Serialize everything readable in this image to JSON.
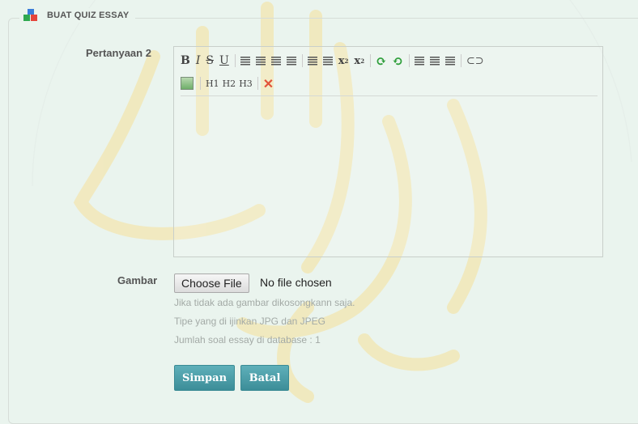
{
  "section": {
    "title": "BUAT QUIZ ESSAY",
    "icon": "blocks-icon"
  },
  "question": {
    "label": "Pertanyaan 2"
  },
  "toolbar": {
    "bold": "B",
    "italic": "I",
    "strike": "S",
    "underline": "U",
    "subscript": "x",
    "superscript": "x",
    "h1": "H1",
    "h2": "H2",
    "h3": "H3"
  },
  "image": {
    "label": "Gambar",
    "choose_label": "Choose File",
    "status": "No file chosen",
    "hints": [
      "Jika tidak ada gambar dikosongkann saja.",
      "Tipe yang di ijinkan JPG dan JPEG",
      "Jumlah soal essay di database : 1"
    ]
  },
  "actions": {
    "save": "Simpan",
    "cancel": "Batal"
  },
  "colors": {
    "button": "#4a9ea8",
    "watermark": "#f3e2a0",
    "remove": "#e2533a"
  }
}
